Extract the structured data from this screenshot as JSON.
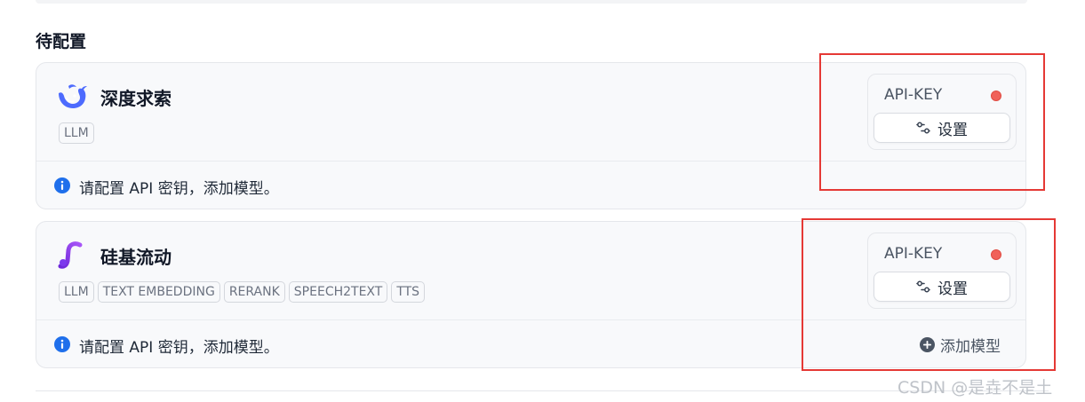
{
  "section": {
    "title": "待配置"
  },
  "providers": [
    {
      "name": "深度求索",
      "tags": [
        "LLM"
      ],
      "apikey_label": "API-KEY",
      "settings_label": "设置",
      "notice": "请配置 API 密钥，添加模型。",
      "status_color": "#f0625a",
      "logo_color": "#4d6bfe"
    },
    {
      "name": "硅基流动",
      "tags": [
        "LLM",
        "TEXT EMBEDDING",
        "RERANK",
        "SPEECH2TEXT",
        "TTS"
      ],
      "apikey_label": "API-KEY",
      "settings_label": "设置",
      "notice": "请配置 API 密钥，添加模型。",
      "add_model_label": "添加模型",
      "status_color": "#f0625a",
      "logo_color": "#7c3aed"
    }
  ],
  "watermark": "CSDN @是垚不是土",
  "colors": {
    "accent": "#1f6feb",
    "annotation": "#e53935",
    "card_bg": "#f8f9fb"
  },
  "icons": {
    "info": "info-circle-icon",
    "settings": "sliders-icon",
    "add": "plus-circle-icon"
  }
}
